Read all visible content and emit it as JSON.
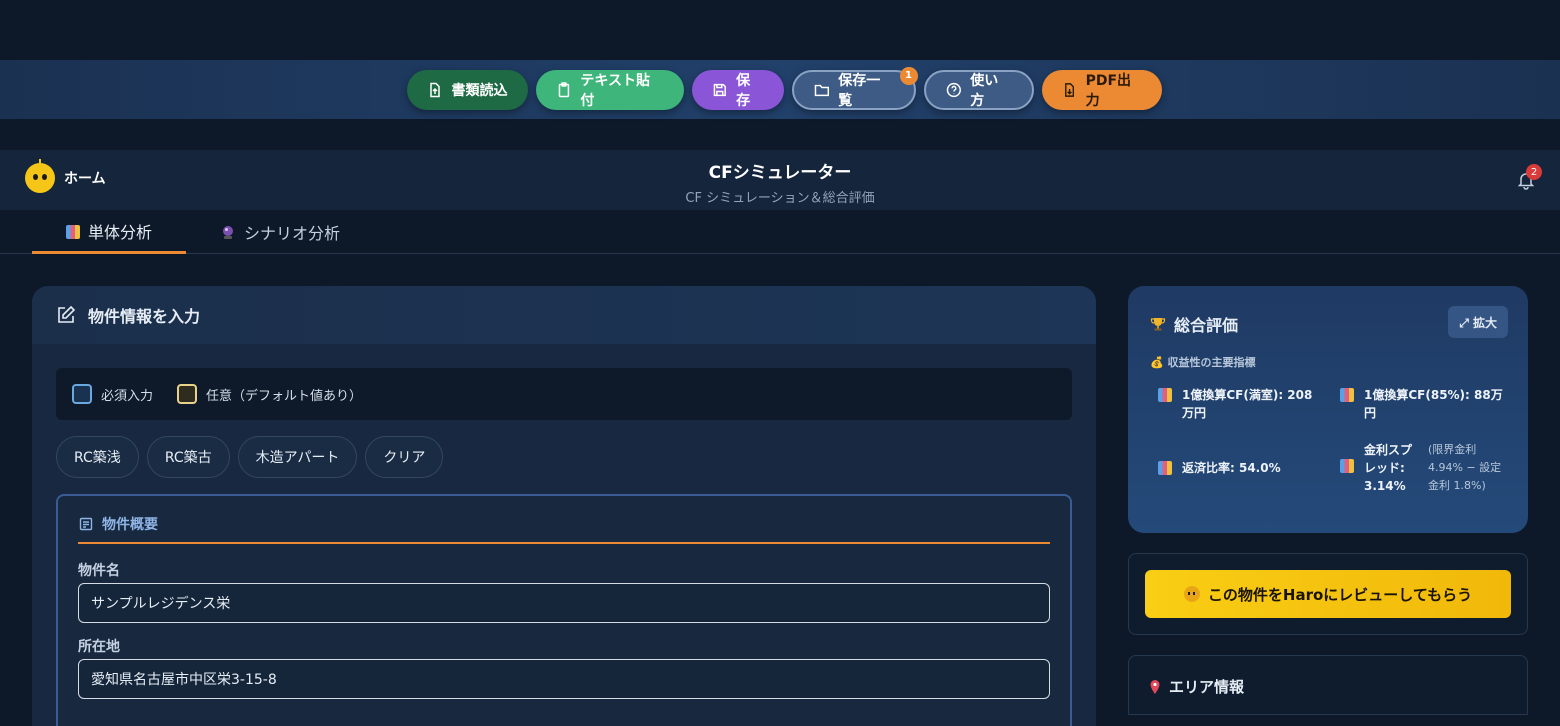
{
  "toolbar": {
    "read_docs": "書類読込",
    "paste_text": "テキスト貼付",
    "save": "保存",
    "saved_list": "保存一覧",
    "saved_list_badge": "1",
    "howto": "使い方",
    "pdf": "PDF出力"
  },
  "header": {
    "home": "ホーム",
    "title": "CFシミュレーター",
    "subtitle": "CF シミュレーション＆総合評価",
    "notification_count": "2"
  },
  "tabs": [
    {
      "label": "単体分析",
      "icon": "bar-chart-icon",
      "active": true
    },
    {
      "label": "シナリオ分析",
      "icon": "crystal-ball-icon",
      "active": false
    }
  ],
  "form": {
    "heading": "物件情報を入力",
    "legend": {
      "required": "必須入力",
      "optional": "任意（デフォルト値あり）"
    },
    "presets": [
      "RC築浅",
      "RC築古",
      "木造アパート",
      "クリア"
    ],
    "section_title": "物件概要",
    "name_label": "物件名",
    "name_value": "サンプルレジデンス栄",
    "address_label": "所在地",
    "address_value": "愛知県名古屋市中区栄3-15-8"
  },
  "score": {
    "title": "総合評価",
    "expand": "⤢ 拡大",
    "metrics_heading": "収益性の主要指標",
    "cf_full": "1億換算CF(満室): 208万円",
    "cf_85": "1億換算CF(85%): 88万円",
    "repayment": "返済比率: 54.0%",
    "spread": "金利スプレッド: 3.14%",
    "spread_note": "(限界金利4.94% − 設定金利 1.8%)"
  },
  "review": {
    "label": "この物件をHaroにレビューしてもらう"
  },
  "area": {
    "title": "エリア情報"
  },
  "colors": {
    "accent": "#ec8a33",
    "review": "#f9ce14",
    "bg": "#0d1828"
  }
}
